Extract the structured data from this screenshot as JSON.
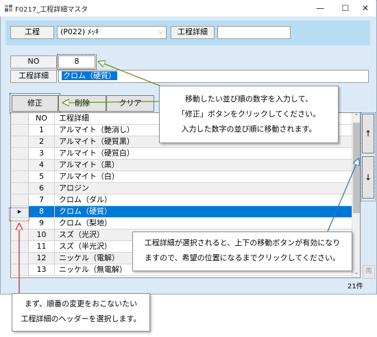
{
  "window": {
    "title": "F0217_工程詳細マスタ",
    "min_glyph": "—",
    "max_glyph": "☐",
    "close_glyph": "✕"
  },
  "filter": {
    "process_label": "工程",
    "process_value": "(P022) ﾒｯｷ",
    "detail_label": "工程詳細",
    "detail_value": ""
  },
  "form": {
    "no_label": "NO",
    "no_value": "8",
    "detail_label": "工程詳細",
    "detail_value": "クロム（硬質）"
  },
  "buttons": {
    "edit": "修正",
    "delete": "削除",
    "clear": "クリア",
    "up": "↑",
    "down": "↓",
    "return": "再"
  },
  "grid": {
    "headers": [
      "NO",
      "工程詳細"
    ],
    "rows": [
      {
        "no": "1",
        "name": "アルマイト（艶消し）"
      },
      {
        "no": "2",
        "name": "アルマイト（硬質黒）"
      },
      {
        "no": "3",
        "name": "アルマイト（硬質白）"
      },
      {
        "no": "4",
        "name": "アルマイト（黒）"
      },
      {
        "no": "5",
        "name": "アルマイト（白）"
      },
      {
        "no": "6",
        "name": "アロジン"
      },
      {
        "no": "7",
        "name": "クロム（ダル）"
      },
      {
        "no": "8",
        "name": "クロム（硬質）"
      },
      {
        "no": "9",
        "name": "クロム（梨地）"
      },
      {
        "no": "10",
        "name": "スズ（光沢）"
      },
      {
        "no": "11",
        "name": "スズ（半光沢）"
      },
      {
        "no": "12",
        "name": "ニッケル（電解）"
      },
      {
        "no": "13",
        "name": "ニッケル（無電解）"
      }
    ],
    "selected_index": 7,
    "count_text": "21件"
  },
  "callouts": {
    "top": [
      "移動したい並び順の数字を入力して、",
      "「修正」ボタンをクリックしてください。",
      "入力した数字の並び順に移動されます。"
    ],
    "middle": [
      "工程詳細が選択されると、上下の移動ボタンが有効になり",
      "ますので、希望の位置になるまでクリックしてください。"
    ],
    "bottom": [
      "まず、順番の変更をおこないたい",
      "工程詳細のヘッダーを選択します。"
    ]
  },
  "colors": {
    "selection": "#0078d7",
    "annotation_green": "#6b8e23",
    "annotation_blue": "#2e75b6",
    "annotation_red": "#e02020"
  }
}
